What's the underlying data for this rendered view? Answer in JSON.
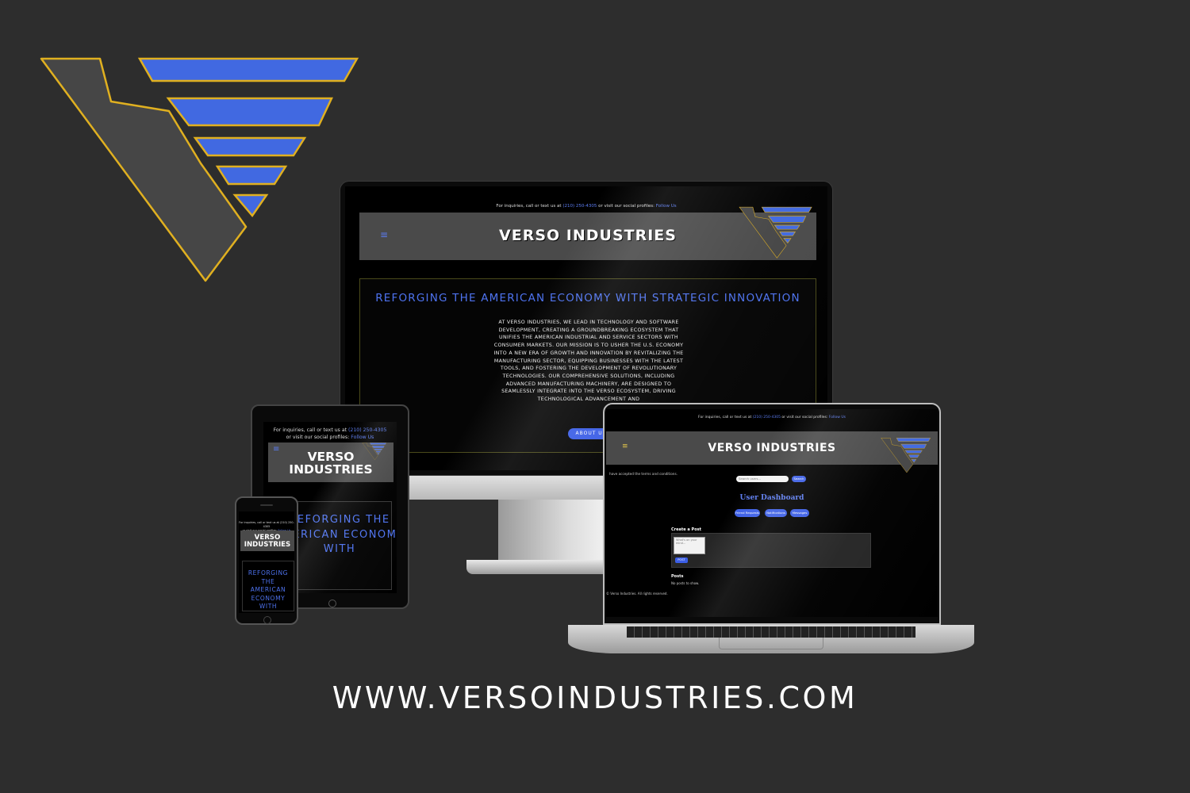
{
  "brand": {
    "name": "VERSO INDUSTRIES",
    "colors": {
      "accent_blue": "#4169e1",
      "outline_gold": "#e0b020",
      "logo_gray": "#4a4a4a",
      "background": "#2d2d2d"
    },
    "logo_icon": "verso-v-logo"
  },
  "desktop_site": {
    "contact_bar": {
      "text": "For inquiries, call or text us at",
      "phone": "(210) 250-4305",
      "middle": "or visit our social profiles:",
      "link": "Follow Us"
    },
    "header": {
      "menu_icon": "hamburger-icon",
      "title": "VERSO INDUSTRIES"
    },
    "hero": {
      "heading": "REFORGING THE AMERICAN ECONOMY WITH STRATEGIC INNOVATION",
      "body": "AT VERSO INDUSTRIES, WE LEAD IN TECHNOLOGY AND SOFTWARE DEVELOPMENT, CREATING A GROUNDBREAKING ECOSYSTEM THAT UNIFIES THE AMERICAN INDUSTRIAL AND SERVICE SECTORS WITH CONSUMER MARKETS. OUR MISSION IS TO USHER THE U.S. ECONOMY INTO A NEW ERA OF GROWTH AND INNOVATION BY REVITALIZING THE MANUFACTURING SECTOR, EQUIPPING BUSINESSES WITH THE LATEST TOOLS, AND FOSTERING THE DEVELOPMENT OF REVOLUTIONARY TECHNOLOGIES. OUR COMPREHENSIVE SOLUTIONS, INCLUDING ADVANCED MANUFACTURING MACHINERY, ARE DESIGNED TO SEAMLESSLY INTEGRATE INTO THE VERSO ECOSYSTEM, DRIVING TECHNOLOGICAL ADVANCEMENT AND",
      "button": "ABOUT US"
    }
  },
  "tablet_site": {
    "contact_line1": "For inquiries, call or text us at",
    "phone": "(210) 250-4305",
    "contact_line2": "or visit our social profiles:",
    "link": "Follow Us",
    "title": "VERSO INDUSTRIES",
    "heading": "REFORGING THE AMERICAN ECONOMY WITH"
  },
  "phone_site": {
    "contact_line1": "For inquiries, call or text us at (210) 250-4305",
    "contact_line2": "or visit our social profiles:",
    "link": "Follow Us",
    "title": "VERSO INDUSTRIES",
    "heading": "REFORGING THE AMERICAN ECONOMY WITH"
  },
  "laptop_site": {
    "contact_bar": {
      "text": "For inquiries, call or text us at",
      "phone": "(210) 250-4305",
      "middle": "or visit our social profiles:",
      "link": "Follow Us"
    },
    "header": {
      "menu_icon": "hamburger-icon",
      "title": "VERSO INDUSTRIES"
    },
    "terms_notice": "have accepted the terms and conditions.",
    "search": {
      "placeholder": "Search users...",
      "button": "Search"
    },
    "dashboard_title": "User Dashboard",
    "pills": [
      "Friend Requests",
      "Notifications",
      "Messages"
    ],
    "create_post": {
      "label": "Create a Post",
      "placeholder": "What's on your mind...",
      "button": "POST"
    },
    "posts": {
      "label": "Posts",
      "empty": "No posts to show."
    },
    "footer": "© Verso Industries. All rights reserved."
  },
  "website_url": "WWW.VERSOINDUSTRIES.COM"
}
